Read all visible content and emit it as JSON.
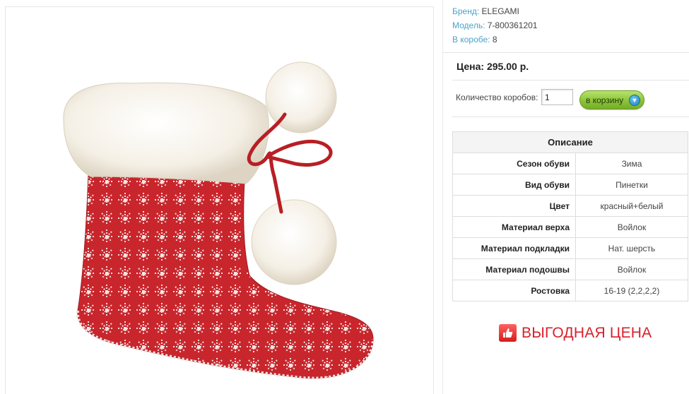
{
  "product": {
    "brand_label": "Бренд:",
    "brand": "ELEGAMI",
    "model_label": "Модель:",
    "model": "7-800361201",
    "box_label": "В коробе:",
    "box_qty": "8",
    "price_text": "Цена: 295.00 р."
  },
  "order": {
    "qty_label": "Количество коробов:",
    "qty_value": "1",
    "cart_button": "в корзину",
    "cart_icon": "cart-down-arrow-icon"
  },
  "description": {
    "title": "Описание",
    "rows": [
      {
        "key": "Сезон обуви",
        "value": "Зима"
      },
      {
        "key": "Вид обуви",
        "value": "Пинетки"
      },
      {
        "key": "Цвет",
        "value": "красный+белый"
      },
      {
        "key": "Материал верха",
        "value": "Войлок"
      },
      {
        "key": "Материал подкладки",
        "value": "Нат. шерсть"
      },
      {
        "key": "Материал подошвы",
        "value": "Войлок"
      },
      {
        "key": "Ростовка",
        "value": "16-19 (2,2,2,2)"
      }
    ]
  },
  "promo": {
    "text": "ВЫГОДНАЯ ЦЕНА",
    "icon": "thumbs-up-icon"
  },
  "colors": {
    "link_label": "#4aa3c9",
    "button_green": "#8cc43a",
    "promo_red": "#d8202a",
    "boot_red": "#c8262c"
  }
}
